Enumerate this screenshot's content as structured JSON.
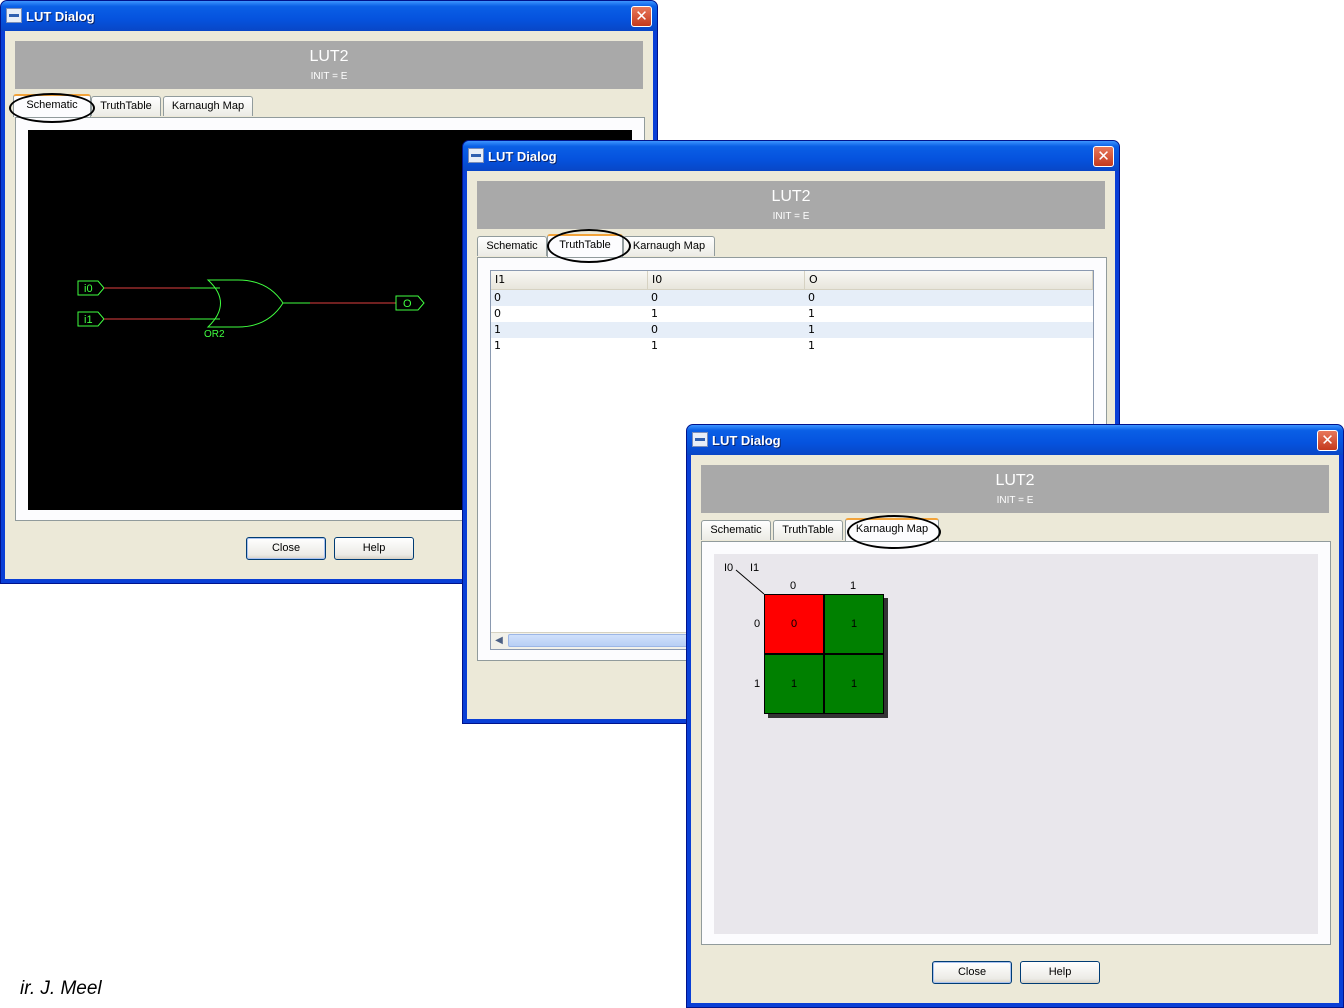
{
  "dialogs": {
    "schematic": {
      "title": "LUT Dialog",
      "header_title": "LUT2",
      "header_sub": "INIT = E",
      "tabs": [
        "Schematic",
        "TruthTable",
        "Karnaugh Map"
      ],
      "active_tab": "Schematic",
      "schematic": {
        "in0": "i0",
        "in1": "i1",
        "gate": "OR2",
        "out": "O"
      },
      "buttons": {
        "close": "Close",
        "help": "Help"
      }
    },
    "truthtable": {
      "title": "LUT Dialog",
      "header_title": "LUT2",
      "header_sub": "INIT = E",
      "tabs": [
        "Schematic",
        "TruthTable",
        "Karnaugh Map"
      ],
      "active_tab": "TruthTable",
      "columns": [
        "I1",
        "I0",
        "O"
      ],
      "rows": [
        [
          "0",
          "0",
          "0"
        ],
        [
          "0",
          "1",
          "1"
        ],
        [
          "1",
          "0",
          "1"
        ],
        [
          "1",
          "1",
          "1"
        ]
      ]
    },
    "kmap": {
      "title": "LUT Dialog",
      "header_title": "LUT2",
      "header_sub": "INIT = E",
      "tabs": [
        "Schematic",
        "TruthTable",
        "Karnaugh Map"
      ],
      "active_tab": "Karnaugh Map",
      "corner_row_var": "I0",
      "corner_col_var": "I1",
      "col_labels": [
        "0",
        "1"
      ],
      "row_labels": [
        "0",
        "1"
      ],
      "cells": [
        [
          "0",
          "1"
        ],
        [
          "1",
          "1"
        ]
      ],
      "colors": {
        "zero": "#ff0000",
        "one": "#008000"
      },
      "buttons": {
        "close": "Close",
        "help": "Help"
      }
    }
  },
  "author": "ir. J. Meel",
  "colors": {
    "schematic_bg": "#000000",
    "schematic_wire_in": "#e04040",
    "schematic_fg": "#40ff40",
    "header_bg": "#a9a9a9",
    "title_bar": "#0553de"
  }
}
